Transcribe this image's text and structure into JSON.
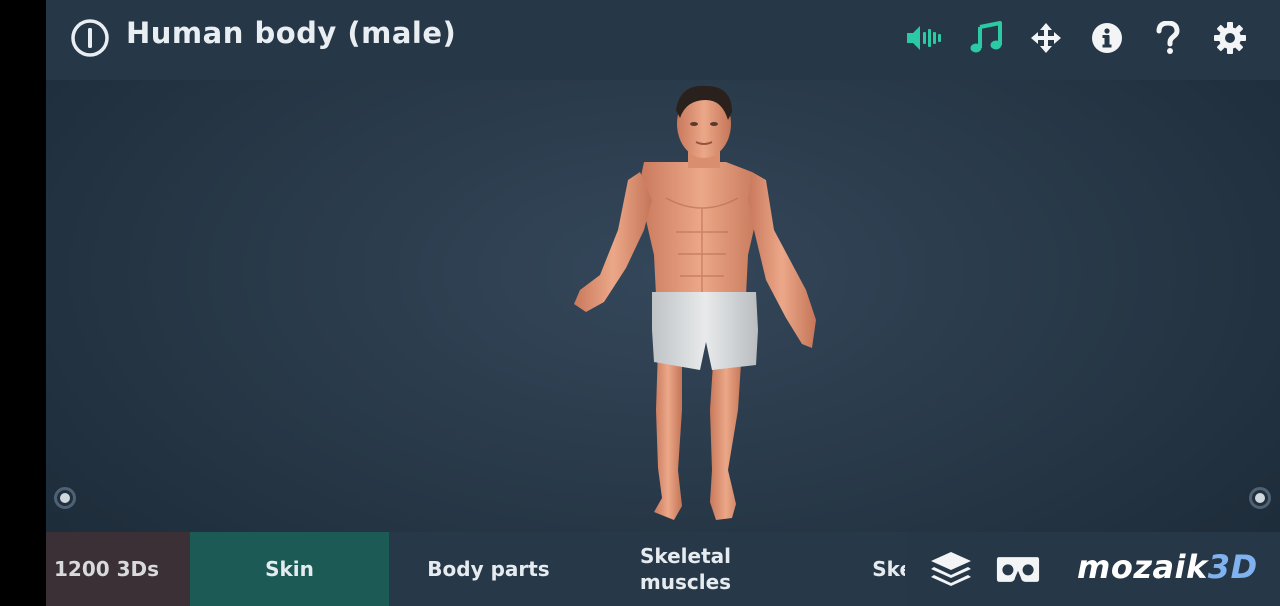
{
  "header": {
    "title": "Human body (male)"
  },
  "icons": {
    "power": "power-icon",
    "sound": "speaker-icon",
    "music": "music-note-icon",
    "move": "move-arrows-icon",
    "info": "info-icon",
    "help": "question-icon",
    "settings": "gear-icon",
    "layers": "layers-icon",
    "vr": "vr-headset-icon"
  },
  "colors": {
    "accent": "#2bc9a4",
    "topbar": "#263747",
    "active_tab": "#1c5a56"
  },
  "bottom_tabs": {
    "count_label": "1200 3Ds",
    "skin": "Skin",
    "body_parts": "Body parts",
    "skeletal_line1": "Skeletal",
    "skeletal_line2": "muscles",
    "skelet": "Skelet"
  },
  "brand": {
    "name": "mozaik",
    "accent": "3D"
  }
}
